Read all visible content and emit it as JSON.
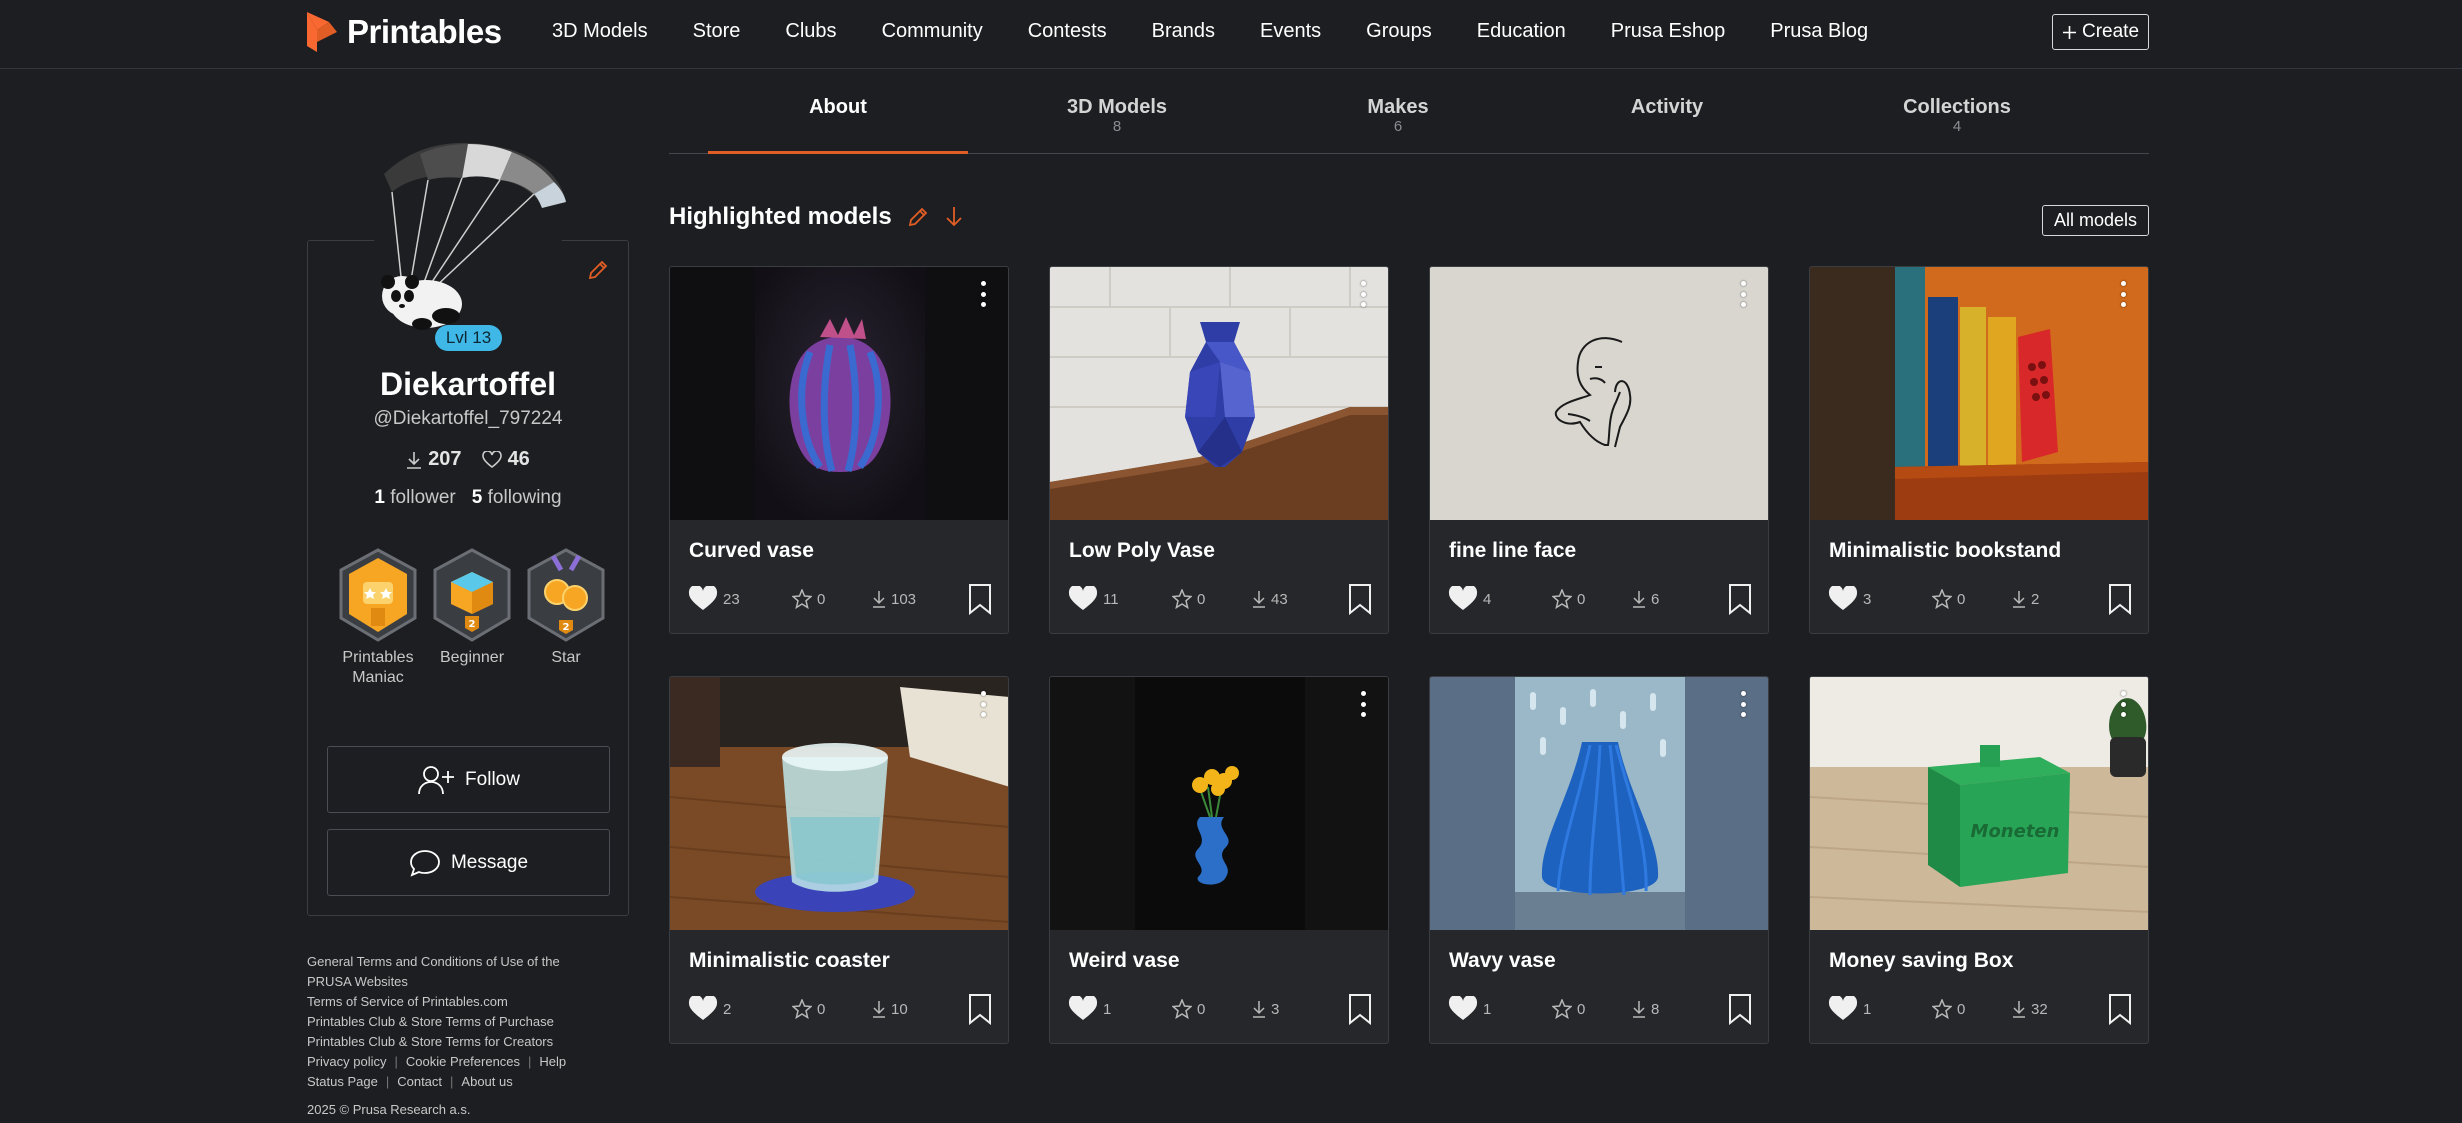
{
  "nav": {
    "brand": "Printables",
    "links": [
      "3D Models",
      "Store",
      "Clubs",
      "Community",
      "Contests",
      "Brands",
      "Events",
      "Groups",
      "Education",
      "Prusa Eshop",
      "Prusa Blog"
    ],
    "create_label": "Create"
  },
  "tabs": [
    {
      "label": "About",
      "count": ""
    },
    {
      "label": "3D Models",
      "count": "8"
    },
    {
      "label": "Makes",
      "count": "6"
    },
    {
      "label": "Activity",
      "count": ""
    },
    {
      "label": "Collections",
      "count": "4"
    }
  ],
  "profile": {
    "level": "Lvl 13",
    "name": "Diekartoffel",
    "handle": "@Diekartoffel_797224",
    "downloads": "207",
    "likes": "46",
    "followers_count": "1",
    "followers_label": "follower",
    "following_count": "5",
    "following_label": "following",
    "badges": [
      "Printables Maniac",
      "Beginner",
      "Star"
    ],
    "follow_label": "Follow",
    "message_label": "Message"
  },
  "highlighted": {
    "title": "Highlighted models",
    "all_models_label": "All models",
    "models": [
      {
        "name": "Curved vase",
        "likes": "23",
        "stars": "0",
        "downloads": "103"
      },
      {
        "name": "Low Poly Vase",
        "likes": "11",
        "stars": "0",
        "downloads": "43"
      },
      {
        "name": "fine line face",
        "likes": "4",
        "stars": "0",
        "downloads": "6"
      },
      {
        "name": "Minimalistic bookstand",
        "likes": "3",
        "stars": "0",
        "downloads": "2"
      },
      {
        "name": "Minimalistic coaster",
        "likes": "2",
        "stars": "0",
        "downloads": "10"
      },
      {
        "name": "Weird vase",
        "likes": "1",
        "stars": "0",
        "downloads": "3"
      },
      {
        "name": "Wavy vase",
        "likes": "1",
        "stars": "0",
        "downloads": "8"
      },
      {
        "name": "Money saving Box",
        "likes": "1",
        "stars": "0",
        "downloads": "32"
      }
    ]
  },
  "footer": {
    "terms_line1": "General Terms and Conditions of Use of the",
    "terms_line2": "PRUSA Websites",
    "tos": "Terms of Service of Printables.com",
    "purchase": "Printables Club & Store Terms of Purchase",
    "creators": "Printables Club & Store Terms for Creators",
    "privacy": "Privacy policy",
    "cookies": "Cookie Preferences",
    "help": "Help",
    "status": "Status Page",
    "contact": "Contact",
    "about": "About us",
    "copyright": "2025 © Prusa Research a.s."
  },
  "colors": {
    "background": "#1c1e21",
    "card": "#25272b",
    "accent": "#e05d25",
    "level_badge": "#3fb8e8"
  },
  "icons": {
    "like": "heart-icon",
    "star": "star-icon",
    "download": "download-icon",
    "save": "bookmark-icon",
    "more": "kebab-menu-icon"
  }
}
